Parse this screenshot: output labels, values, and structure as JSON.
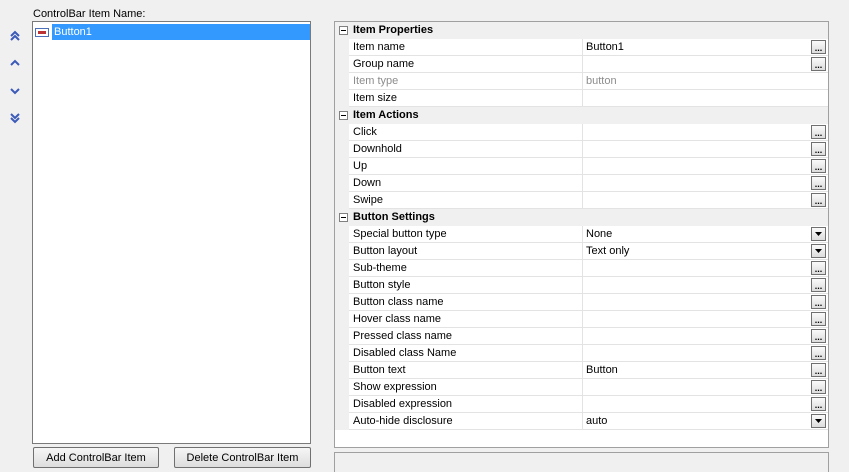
{
  "list": {
    "label": "ControlBar Item Name:",
    "items": [
      {
        "label": "Button1",
        "icon": "abc-button-icon",
        "selected": true
      }
    ]
  },
  "move_buttons": [
    "move-top-icon",
    "move-up-icon",
    "move-down-icon",
    "move-bottom-icon"
  ],
  "buttons": {
    "add": "Add ControlBar Item",
    "delete": "Delete ControlBar Item"
  },
  "colors": {
    "selection": "#3399ff",
    "arrow": "#3c5ab8"
  },
  "property_grid": {
    "categories": [
      {
        "label": "Item Properties",
        "rows": [
          {
            "name": "Item name",
            "value": "Button1",
            "button": "ellipsis"
          },
          {
            "name": "Group name",
            "value": "",
            "button": "ellipsis"
          },
          {
            "name": "Item type",
            "value": "button",
            "button": "",
            "disabled": true
          },
          {
            "name": "Item size",
            "value": "",
            "button": ""
          }
        ]
      },
      {
        "label": "Item Actions",
        "rows": [
          {
            "name": "Click",
            "value": "",
            "button": "ellipsis"
          },
          {
            "name": "Downhold",
            "value": "",
            "button": "ellipsis"
          },
          {
            "name": "Up",
            "value": "",
            "button": "ellipsis"
          },
          {
            "name": "Down",
            "value": "",
            "button": "ellipsis"
          },
          {
            "name": "Swipe",
            "value": "",
            "button": "ellipsis"
          }
        ]
      },
      {
        "label": "Button Settings",
        "rows": [
          {
            "name": "Special button type",
            "value": "None",
            "button": "dropdown"
          },
          {
            "name": "Button layout",
            "value": "Text only",
            "button": "dropdown"
          },
          {
            "name": "Sub-theme",
            "value": "",
            "button": "ellipsis"
          },
          {
            "name": "Button style",
            "value": "",
            "button": "ellipsis"
          },
          {
            "name": "Button class name",
            "value": "",
            "button": "ellipsis"
          },
          {
            "name": "Hover class name",
            "value": "",
            "button": "ellipsis"
          },
          {
            "name": "Pressed class name",
            "value": "",
            "button": "ellipsis"
          },
          {
            "name": "Disabled class Name",
            "value": "",
            "button": "ellipsis"
          },
          {
            "name": "Button text",
            "value": "Button",
            "button": "ellipsis"
          },
          {
            "name": "Show expression",
            "value": "",
            "button": "ellipsis"
          },
          {
            "name": "Disabled expression",
            "value": "",
            "button": "ellipsis"
          },
          {
            "name": "Auto-hide disclosure",
            "value": "auto",
            "button": "dropdown"
          }
        ]
      }
    ]
  }
}
